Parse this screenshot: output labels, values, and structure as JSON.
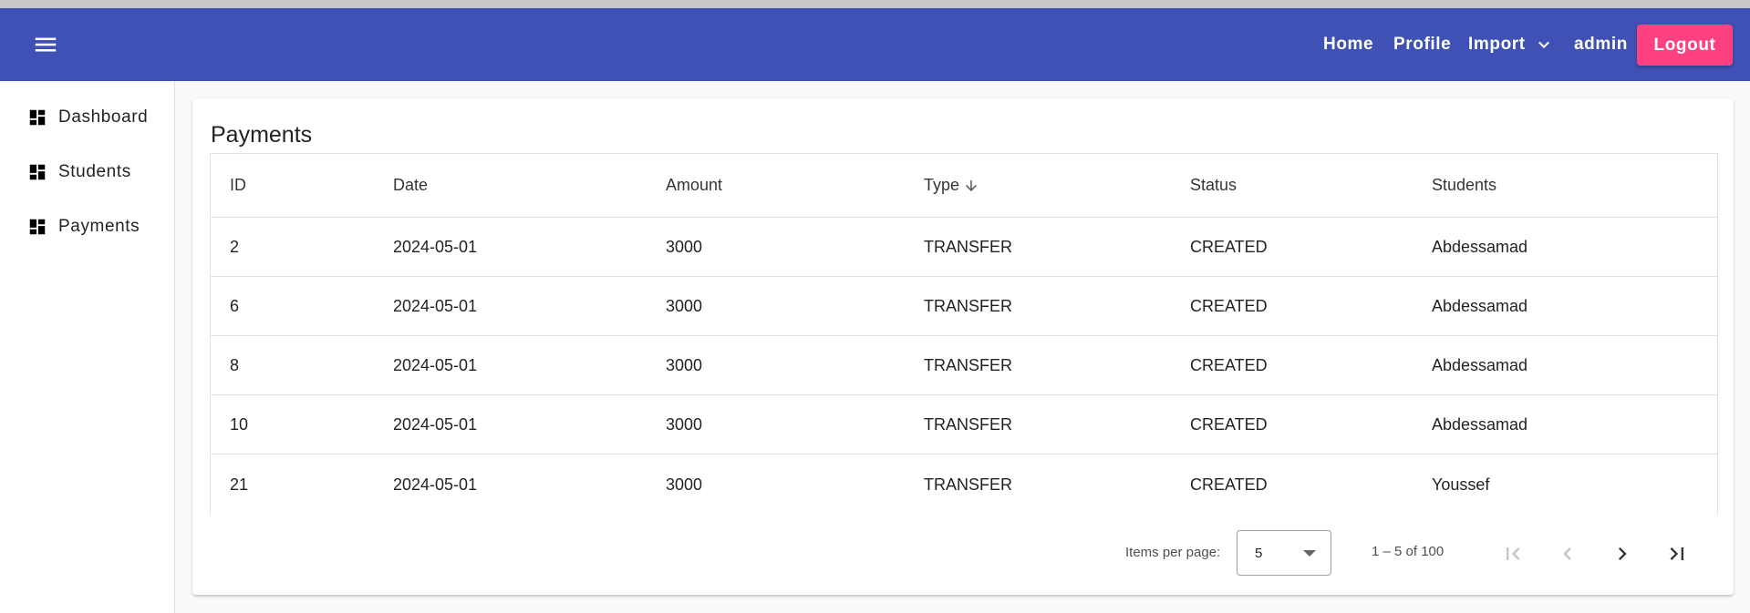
{
  "toolbar": {
    "color": "#3f51b5",
    "menu_icon": "menu-icon",
    "nav": {
      "home": "Home",
      "profile": "Profile",
      "import": "Import",
      "user": "admin"
    },
    "logout_label": "Logout",
    "logout_color": "#ff4081"
  },
  "sidebar": {
    "items": [
      {
        "label": "Dashboard",
        "icon": "dashboard-icon"
      },
      {
        "label": "Students",
        "icon": "dashboard-icon"
      },
      {
        "label": "Payments",
        "icon": "dashboard-icon"
      }
    ]
  },
  "main": {
    "title": "Payments",
    "table": {
      "columns": [
        "ID",
        "Date",
        "Amount",
        "Type",
        "Status",
        "Students"
      ],
      "sorted_column": "Type",
      "sort_direction": "descending",
      "rows": [
        [
          "2",
          "2024-05-01",
          "3000",
          "TRANSFER",
          "CREATED",
          "Abdessamad"
        ],
        [
          "6",
          "2024-05-01",
          "3000",
          "TRANSFER",
          "CREATED",
          "Abdessamad"
        ],
        [
          "8",
          "2024-05-01",
          "3000",
          "TRANSFER",
          "CREATED",
          "Abdessamad"
        ],
        [
          "10",
          "2024-05-01",
          "3000",
          "TRANSFER",
          "CREATED",
          "Abdessamad"
        ],
        [
          "21",
          "2024-05-01",
          "3000",
          "TRANSFER",
          "CREATED",
          "Youssef"
        ]
      ]
    },
    "paginator": {
      "items_per_page_label": "Items per page:",
      "items_per_page_value": "5",
      "range_label": "1 – 5 of 100"
    }
  }
}
